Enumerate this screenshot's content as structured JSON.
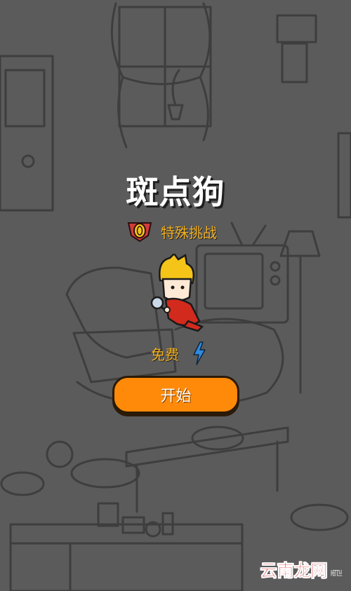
{
  "game": {
    "title": "斑点狗",
    "mode_label": "特殊挑战",
    "cost_label": "免费",
    "start_label": "开始"
  },
  "watermark": {
    "site": "云南龙网",
    "mark": "ꡅꡖ"
  },
  "icons": {
    "mode": "coin-badge-icon",
    "cost": "lightning-bolt-icon",
    "character": "detective-kid-with-magnifier"
  },
  "colors": {
    "background": "#5b5b5b",
    "title": "#ffffff",
    "accent_text": "#f2b020",
    "button": "#ff8a0a",
    "bolt": "#2f8be0",
    "badge": "#d43b3b",
    "watermark": "#e02c2c"
  }
}
